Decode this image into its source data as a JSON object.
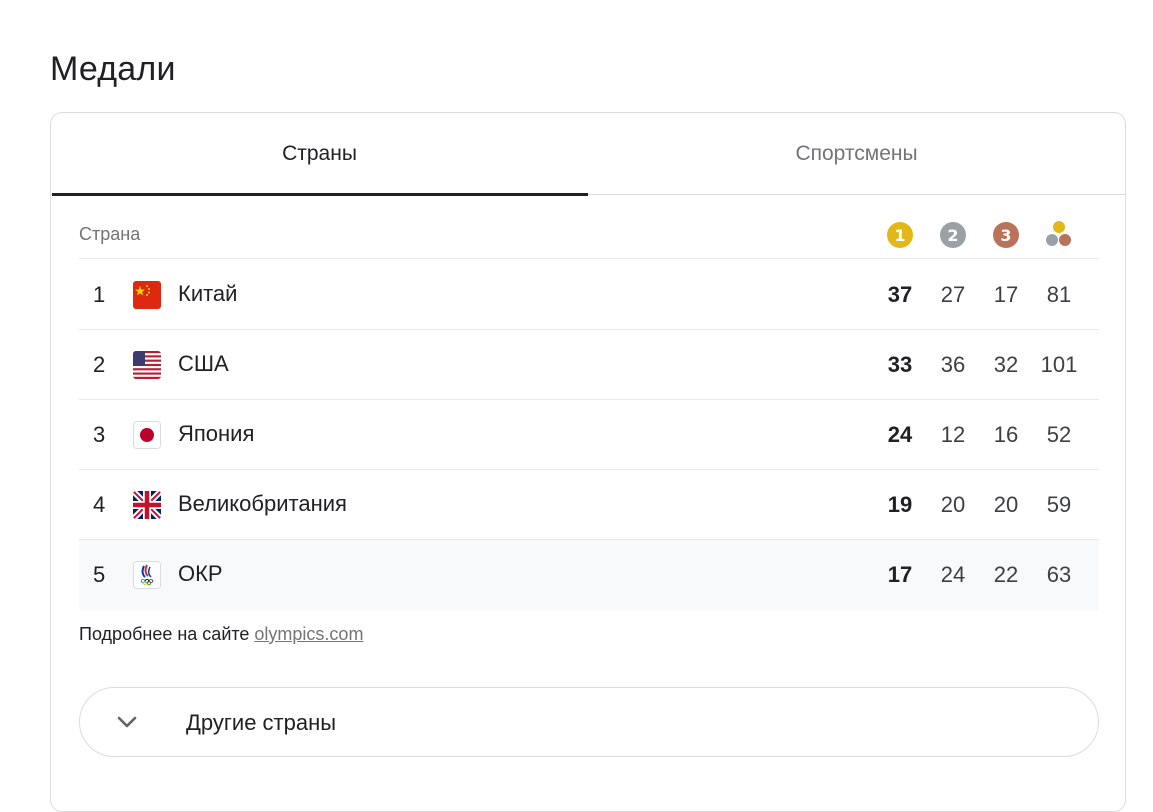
{
  "title": "Медали",
  "tabs": [
    {
      "label": "Страны",
      "active": true
    },
    {
      "label": "Спортсмены",
      "active": false
    }
  ],
  "table": {
    "country_header": "Страна",
    "medal_icons": {
      "gold": "1",
      "silver": "2",
      "bronze": "3"
    },
    "colors": {
      "gold": "#e2b818",
      "silver": "#9aa0a6",
      "bronze": "#b9735a"
    },
    "rows": [
      {
        "rank": "1",
        "flag": "china-flag-icon",
        "country": "Китай",
        "gold": "37",
        "silver": "27",
        "bronze": "17",
        "total": "81"
      },
      {
        "rank": "2",
        "flag": "usa-flag-icon",
        "country": "США",
        "gold": "33",
        "silver": "36",
        "bronze": "32",
        "total": "101"
      },
      {
        "rank": "3",
        "flag": "japan-flag-icon",
        "country": "Япония",
        "gold": "24",
        "silver": "12",
        "bronze": "16",
        "total": "52"
      },
      {
        "rank": "4",
        "flag": "uk-flag-icon",
        "country": "Великобритания",
        "gold": "19",
        "silver": "20",
        "bronze": "20",
        "total": "59"
      },
      {
        "rank": "5",
        "flag": "roc-flag-icon",
        "country": "ОКР",
        "gold": "17",
        "silver": "24",
        "bronze": "22",
        "total": "63"
      }
    ]
  },
  "footer": {
    "more_prefix": "Подробнее на сайте ",
    "more_link": "olympics.com",
    "other_countries": "Другие страны"
  }
}
